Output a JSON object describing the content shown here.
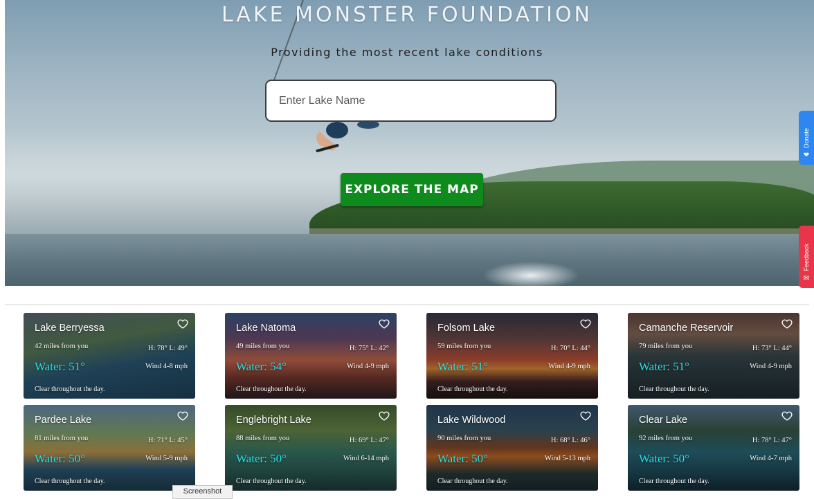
{
  "hero": {
    "title": "LAKE MONSTER FOUNDATION",
    "tagline": "Providing the most recent lake conditions",
    "search_placeholder": "Enter Lake Name",
    "explore_label": "EXPLORE THE MAP"
  },
  "side_tabs": {
    "donate": "Donate",
    "feedback": "Feedback"
  },
  "lakes": [
    {
      "name": "Lake Berryessa",
      "distance": "42 miles from you",
      "hl": "H: 78° L: 49°",
      "water": "Water: 51°",
      "wind": "Wind 4-8 mph",
      "condition": "Clear throughout the day."
    },
    {
      "name": "Lake Natoma",
      "distance": "49 miles from you",
      "hl": "H: 75° L: 42°",
      "water": "Water: 54°",
      "wind": "Wind 4-9 mph",
      "condition": "Clear throughout the day."
    },
    {
      "name": "Folsom Lake",
      "distance": "59 miles from you",
      "hl": "H: 70° L: 44°",
      "water": "Water: 51°",
      "wind": "Wind 4-9 mph",
      "condition": "Clear throughout the day."
    },
    {
      "name": "Camanche Reservoir",
      "distance": "79 miles from you",
      "hl": "H: 73° L: 44°",
      "water": "Water: 51°",
      "wind": "Wind 4-9 mph",
      "condition": "Clear throughout the day."
    },
    {
      "name": "Pardee Lake",
      "distance": "81 miles from you",
      "hl": "H: 71° L: 45°",
      "water": "Water: 50°",
      "wind": "Wind 5-9 mph",
      "condition": "Clear throughout the day."
    },
    {
      "name": "Englebright Lake",
      "distance": "88 miles from you",
      "hl": "H: 69° L: 47°",
      "water": "Water: 50°",
      "wind": "Wind 6-14 mph",
      "condition": "Clear throughout the day."
    },
    {
      "name": "Lake Wildwood",
      "distance": "90 miles from you",
      "hl": "H: 68° L: 46°",
      "water": "Water: 50°",
      "wind": "Wind 5-13 mph",
      "condition": "Clear throughout the day."
    },
    {
      "name": "Clear Lake",
      "distance": "92 miles from you",
      "hl": "H: 78° L: 47°",
      "water": "Water: 50°",
      "wind": "Wind 4-7 mph",
      "condition": "Clear throughout the day."
    }
  ],
  "tooltip": "Screenshot"
}
